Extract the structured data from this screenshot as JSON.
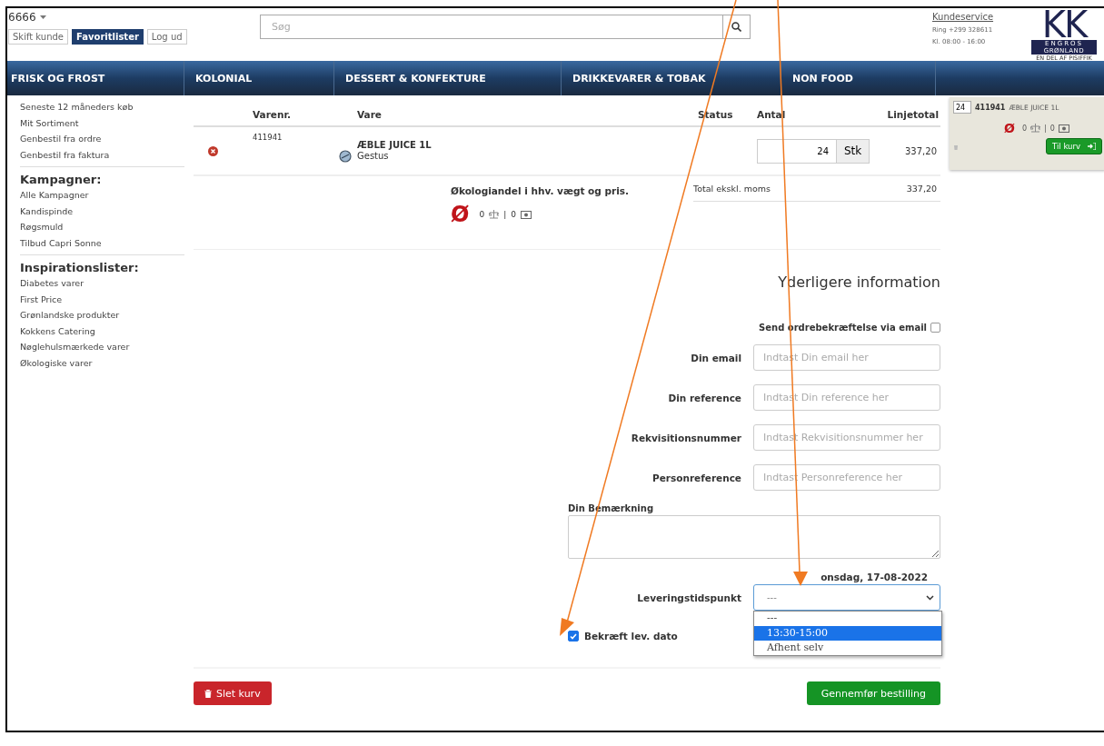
{
  "header": {
    "account": "6666",
    "buttons": [
      {
        "label": "Skift kunde",
        "selected": false
      },
      {
        "label": "Favoritlister",
        "selected": true
      },
      {
        "label": "Log ud",
        "selected": false
      }
    ],
    "search": {
      "placeholder": "Søg"
    },
    "customer_service": {
      "link": "Kundeservice",
      "phone": "Ring +299 328611",
      "hours": "Kl. 08:00 - 16:00"
    },
    "logo": {
      "letters": "KK",
      "line_1": "ENGROS",
      "line_2": "GRØNLAND",
      "tagline": "EN DEL AF PISIFFIK"
    }
  },
  "nav": [
    "FRISK OG FROST",
    "KOLONIAL",
    "DESSERT & KONFEKTURE",
    "DRIKKEVARER & TOBAK",
    "NON FOOD"
  ],
  "sidebar": {
    "groups": [
      {
        "items": [
          "Seneste 12 måneders køb",
          "Mit Sortiment",
          "Genbestil fra ordre",
          "Genbestil fra faktura"
        ]
      },
      {
        "heading": "Kampagner:",
        "items": [
          "Alle Kampagner",
          "Kandispinde",
          "Røgsmuld",
          "Tilbud Capri Sonne"
        ]
      },
      {
        "heading": "Inspirationslister:",
        "items": [
          "Diabetes varer",
          "First Price",
          "Grønlandske produkter",
          "Kokkens Catering",
          "Nøglehulsmærkede varer",
          "Økologiske varer"
        ]
      }
    ]
  },
  "cart_table": {
    "columns": [
      "Varenr.",
      "Vare",
      "Status",
      "Antal",
      "Linjetotal"
    ],
    "rows": [
      {
        "item_no": "411941",
        "name": "ÆBLE JUICE 1L",
        "brand": "Gestus",
        "quantity": "24",
        "unit": "Stk",
        "line_total": "337,20"
      }
    ]
  },
  "organic": {
    "title": "Økologiandel i hhv. vægt og pris.",
    "symbol": "Ø",
    "weight_share": "0",
    "separator": "|",
    "price_share": "0"
  },
  "total": {
    "label": "Total ekskl. moms",
    "value": "337,20"
  },
  "form": {
    "heading": "Yderligere information",
    "email_confirmation": {
      "label": "Send ordrebekræftelse via email",
      "checked": false
    },
    "fields": [
      {
        "label": "Din email",
        "placeholder": "Indtast Din email her"
      },
      {
        "label": "Din reference",
        "placeholder": "Indtast Din reference her"
      },
      {
        "label": "Rekvisitionsnummer",
        "placeholder": "Indtast Rekvisitionsnummer her"
      },
      {
        "label": "Personreference",
        "placeholder": "Indtast Personreference her"
      }
    ],
    "remark": {
      "label": "Din Bemærkning"
    },
    "delivery_date": "onsdag, 17-08-2022",
    "delivery_time": {
      "label": "Leveringstidspunkt",
      "value": "---",
      "expanded": true,
      "options": [
        {
          "label": "---",
          "highlighted": false
        },
        {
          "label": "13:30-15:00",
          "highlighted": true
        },
        {
          "label": "Afhent selv",
          "highlighted": false
        }
      ]
    },
    "confirm_date": {
      "label": "Bekræft lev. dato",
      "checked": true
    }
  },
  "actions": [
    {
      "kind": "danger",
      "label": "Slet kurv"
    },
    {
      "kind": "primary",
      "label": "Gennemfør bestilling"
    }
  ],
  "mini_cart": {
    "quantity": "24",
    "item_no": "411941",
    "name": "ÆBLE JUICE 1L",
    "symbol": "Ø",
    "weight_share": "0",
    "separator": "|",
    "price_share": "0",
    "button": "Til kurv"
  }
}
